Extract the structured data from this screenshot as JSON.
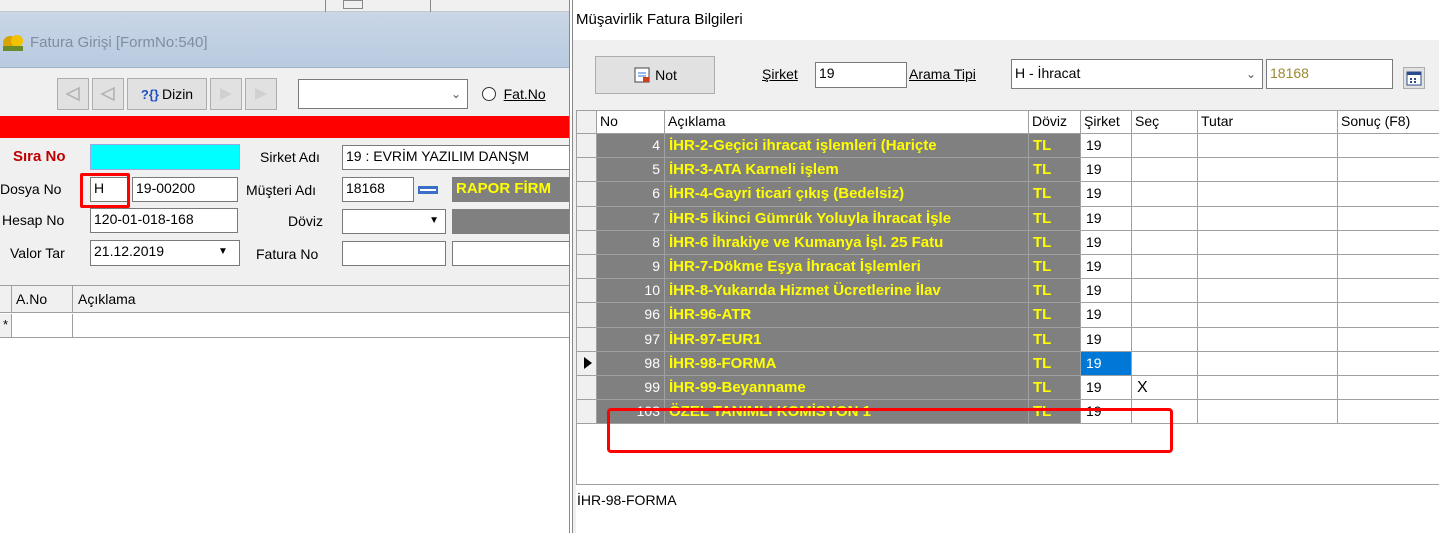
{
  "left": {
    "title": "Fatura Girişi [FormNo:540]",
    "toolbar": {
      "dizin_label": "Dizin",
      "fat_no_label": "Fat.No"
    },
    "labels": {
      "sira_no": "Sıra No",
      "sirket_adi": "Sirket Adı",
      "dosya_no": "Dosya No",
      "musteri_adi": "Müşteri Adı",
      "hesap_no": "Hesap No",
      "doviz": "Döviz",
      "valor_tar": "Valor Tar",
      "fatura_no": "Fatura No"
    },
    "values": {
      "sirket_adi": "19 : EVRİM YAZILIM DANŞM",
      "dosya_prefix": "H",
      "dosya_no": "19-00200",
      "musteri_code": "18168",
      "musteri_name": "RAPOR FİRM",
      "hesap_no": "120-01-018-168",
      "valor_tar": "21.12.2019"
    },
    "grid": {
      "columns": [
        "A.No",
        "Açıklama"
      ],
      "new_row_marker": "*"
    }
  },
  "right": {
    "title": "Müşavirlik Fatura Bilgileri",
    "not_button": "Not",
    "sirket_label": "Şirket",
    "sirket_value": "19",
    "arama_tipi_label": "Arama Tipi",
    "arama_tipi_value": "H - İhracat",
    "code_value": "18168",
    "columns": [
      "No",
      "Açıklama",
      "Döviz",
      "Şirket",
      "Seç",
      "Tutar",
      "Sonuç (F8)"
    ],
    "rows": [
      {
        "no": "4",
        "aciklama": "İHR-2-Geçici ihracat işlemleri (Hariçte",
        "doviz": "TL",
        "sirket": "19",
        "sec": ""
      },
      {
        "no": "5",
        "aciklama": "İHR-3-ATA Karneli işlem",
        "doviz": "TL",
        "sirket": "19",
        "sec": ""
      },
      {
        "no": "6",
        "aciklama": "İHR-4-Gayri ticari çıkış (Bedelsiz)",
        "doviz": "TL",
        "sirket": "19",
        "sec": ""
      },
      {
        "no": "7",
        "aciklama": "İHR-5 İkinci Gümrük Yoluyla İhracat İşle",
        "doviz": "TL",
        "sirket": "19",
        "sec": ""
      },
      {
        "no": "8",
        "aciklama": "İHR-6 İhrakiye ve Kumanya İşl. 25 Fatu",
        "doviz": "TL",
        "sirket": "19",
        "sec": ""
      },
      {
        "no": "9",
        "aciklama": "İHR-7-Dökme Eşya İhracat İşlemleri",
        "doviz": "TL",
        "sirket": "19",
        "sec": ""
      },
      {
        "no": "10",
        "aciklama": "İHR-8-Yukarıda Hizmet Ücretlerine İlav",
        "doviz": "TL",
        "sirket": "19",
        "sec": ""
      },
      {
        "no": "96",
        "aciklama": "İHR-96-ATR",
        "doviz": "TL",
        "sirket": "19",
        "sec": ""
      },
      {
        "no": "97",
        "aciklama": "İHR-97-EUR1",
        "doviz": "TL",
        "sirket": "19",
        "sec": ""
      },
      {
        "no": "98",
        "aciklama": "İHR-98-FORMA",
        "doviz": "TL",
        "sirket": "19",
        "sec": ""
      },
      {
        "no": "99",
        "aciklama": "İHR-99-Beyanname",
        "doviz": "TL",
        "sirket": "19",
        "sec": "X"
      },
      {
        "no": "103",
        "aciklama": "ÖZEL TANIMLI KOMİSYON 1",
        "doviz": "TL",
        "sirket": "19",
        "sec": ""
      }
    ],
    "memo": "İHR-98-FORMA"
  },
  "colors": {
    "gray_row": "#808080",
    "yellow_text": "#ffff00",
    "highlight_red": "#ff0000",
    "selected_blue": "#0078d7",
    "cyan_field": "#00ffff"
  }
}
